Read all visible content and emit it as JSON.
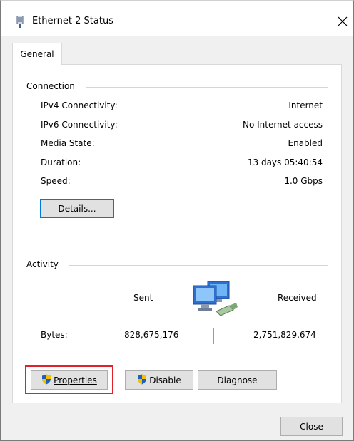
{
  "window": {
    "title": "Ethernet 2 Status",
    "icon": "network-adapter-icon"
  },
  "tabs": [
    {
      "label": "General",
      "selected": true
    }
  ],
  "connection": {
    "group_label": "Connection",
    "rows": [
      {
        "label": "IPv4 Connectivity:",
        "value": "Internet"
      },
      {
        "label": "IPv6 Connectivity:",
        "value": "No Internet access"
      },
      {
        "label": "Media State:",
        "value": "Enabled"
      },
      {
        "label": "Duration:",
        "value": "13 days 05:40:54"
      },
      {
        "label": "Speed:",
        "value": "1.0 Gbps"
      }
    ],
    "details_button": "Details..."
  },
  "activity": {
    "group_label": "Activity",
    "sent_label": "Sent",
    "received_label": "Received",
    "bytes_label": "Bytes:",
    "bytes_sent": "828,675,176",
    "bytes_received": "2,751,829,674",
    "icon": "network-computers-icon"
  },
  "buttons": {
    "properties": "Properties",
    "disable": "Disable",
    "diagnose": "Diagnose",
    "close": "Close"
  },
  "colors": {
    "highlight": "#e0202a",
    "focus": "#0078d7",
    "dialog_bg": "#f0f0f0"
  }
}
